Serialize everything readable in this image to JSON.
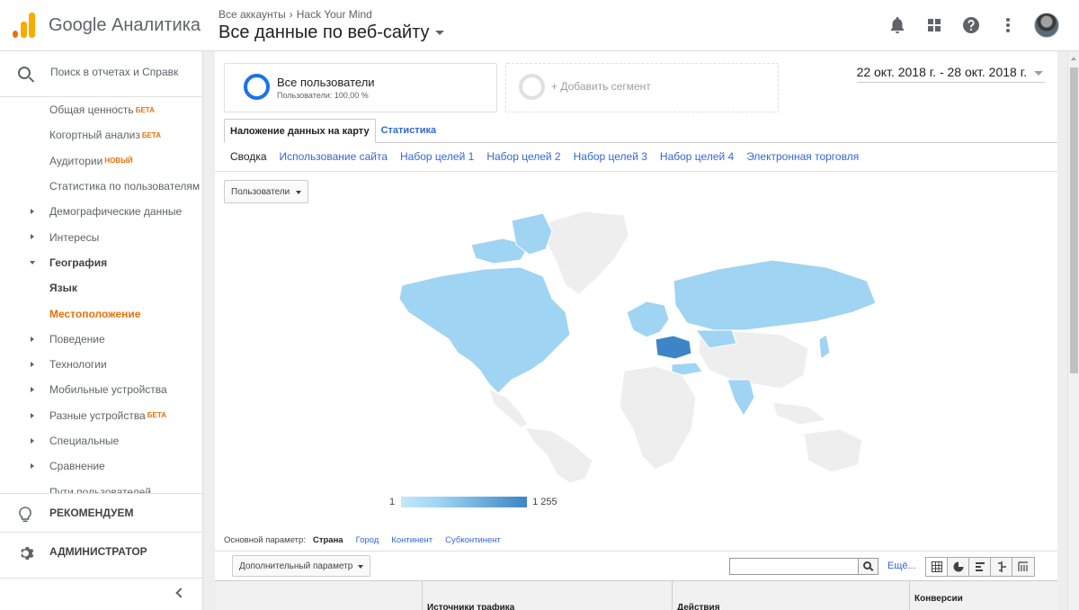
{
  "header": {
    "brand": "Google Аналитика",
    "breadcrumb": {
      "all_accounts": "Все аккаунты",
      "separator": "›",
      "account": "Hack Your Mind"
    },
    "property_title": "Все данные по веб-сайту",
    "icons": [
      "bell-icon",
      "apps-grid-icon",
      "help-icon",
      "more-vert-icon",
      "avatar"
    ]
  },
  "sidebar": {
    "search_placeholder": "Поиск в отчетах и Справк",
    "items": [
      {
        "label": "Общая ценность",
        "badge": "БЕТА"
      },
      {
        "label": "Когортный анализ",
        "badge": "БЕТА"
      },
      {
        "label": "Аудитории",
        "badge": "НОВЫЙ"
      },
      {
        "label": "Статистика по пользователям"
      },
      {
        "label": "Демографические данные"
      },
      {
        "label": "Интересы"
      },
      {
        "label": "География"
      },
      {
        "label": "Язык"
      },
      {
        "label": "Местоположение"
      },
      {
        "label": "Поведение"
      },
      {
        "label": "Технологии"
      },
      {
        "label": "Мобильные устройства"
      },
      {
        "label": "Разные устройства",
        "badge": "БЕТА"
      },
      {
        "label": "Специальные"
      },
      {
        "label": "Сравнение"
      },
      {
        "label": "Пути пользователей"
      }
    ],
    "recommend": "РЕКОМЕНДУЕМ",
    "admin": "АДМИНИСТРАТОР"
  },
  "segments": {
    "primary_title": "Все пользователи",
    "primary_sub": "Пользователи: 100,00 %",
    "add_label": "+ Добавить сегмент"
  },
  "date_range": "22 окт. 2018 г. - 28 окт. 2018 г.",
  "tabs": [
    "Наложение данных на карту",
    "Статистика"
  ],
  "subtabs": [
    "Сводка",
    "Использование сайта",
    "Набор целей 1",
    "Набор целей 2",
    "Набор целей 3",
    "Набор целей 4",
    "Электронная торговля"
  ],
  "metric_select": "Пользователи",
  "map": {
    "legend_min": "1",
    "legend_max": "1 255",
    "colors": {
      "low": "#9fd4f3",
      "high": "#3d85c6",
      "none": "#eeeeee",
      "border": "#ffffff"
    }
  },
  "dimensions": {
    "label": "Основной параметр:",
    "current": "Страна",
    "links": [
      "Город",
      "Континент",
      "Субконтинент"
    ]
  },
  "table_controls": {
    "secondary_dim": "Дополнительный параметр",
    "search_value": "",
    "more": "Ещё..."
  },
  "table_headers": [
    "Источники трафика",
    "Действия",
    "Конверсии"
  ]
}
